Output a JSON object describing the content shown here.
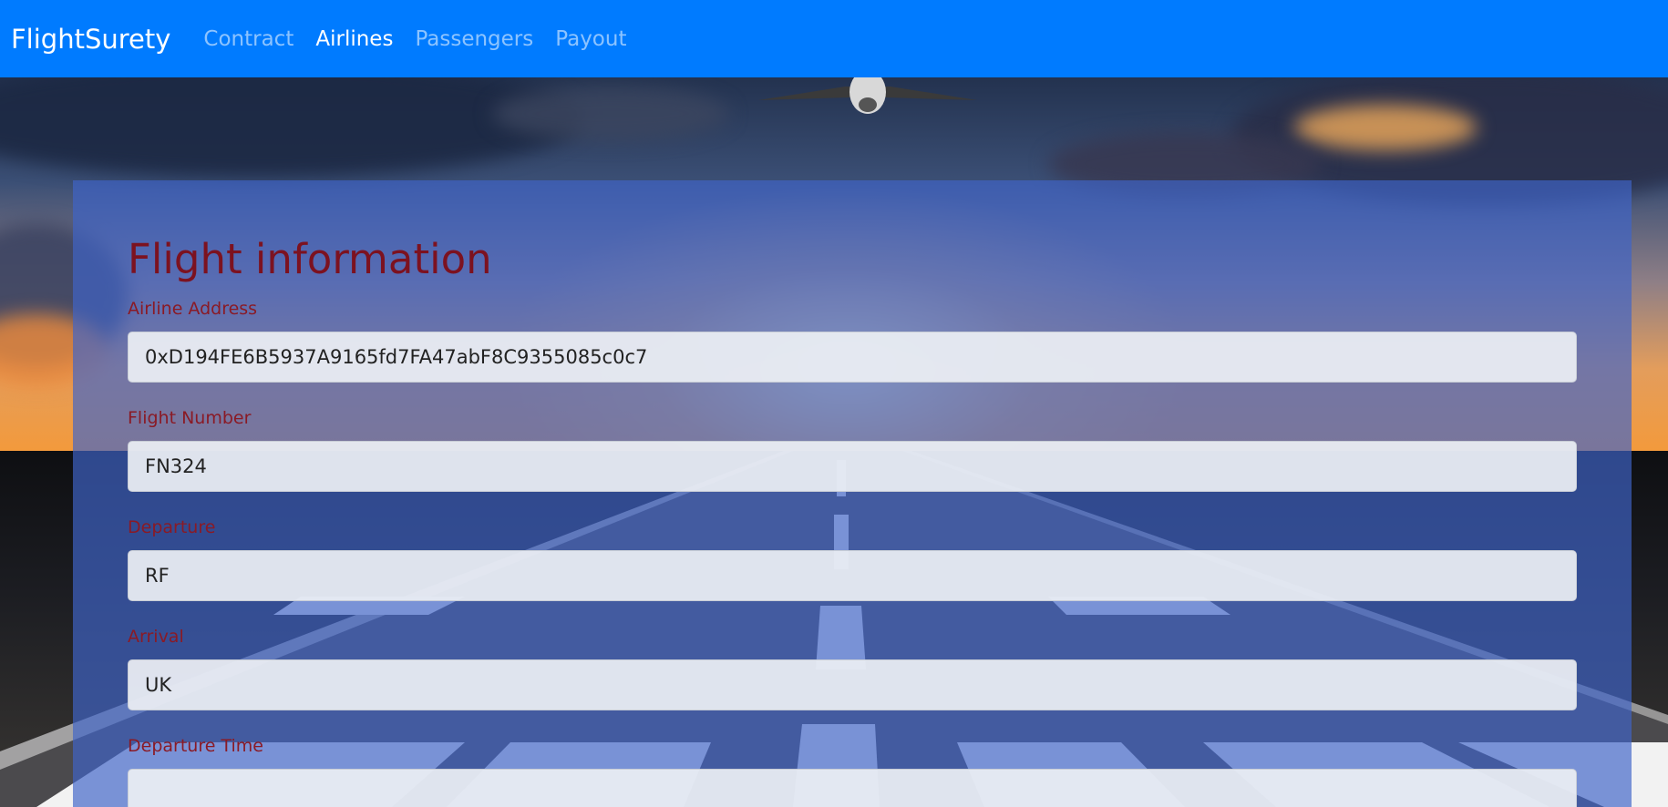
{
  "navbar": {
    "brand": "FlightSurety",
    "links": [
      {
        "label": "Contract",
        "active": false
      },
      {
        "label": "Airlines",
        "active": true
      },
      {
        "label": "Passengers",
        "active": false
      },
      {
        "label": "Payout",
        "active": false
      }
    ],
    "color": "#007bff"
  },
  "form": {
    "title": "Flight information",
    "fields": [
      {
        "label": "Airline Address",
        "value": "0xD194FE6B5937A9165fd7FA47abF8C9355085c0c7"
      },
      {
        "label": "Flight Number",
        "value": "FN324"
      },
      {
        "label": "Departure",
        "value": "RF"
      },
      {
        "label": "Arrival",
        "value": "UK"
      },
      {
        "label": "Departure Time",
        "value": ""
      }
    ]
  },
  "colors": {
    "heading": "#7c1220",
    "label": "#8a1a25",
    "card_overlay": "rgba(64,100,200,0.68)"
  }
}
